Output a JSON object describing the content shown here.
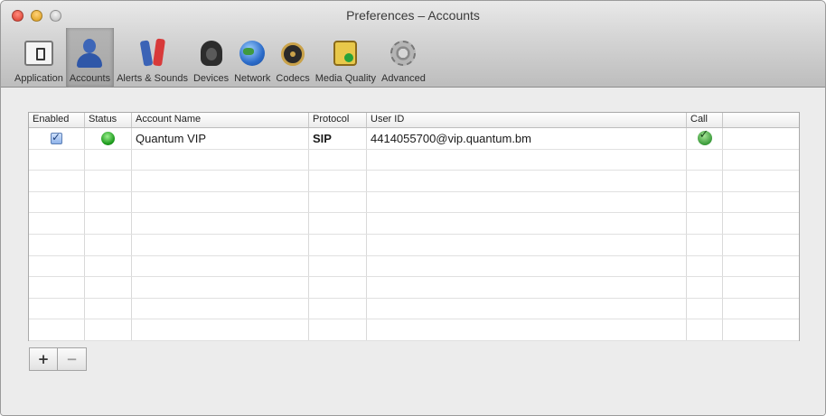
{
  "window": {
    "title": "Preferences – Accounts"
  },
  "toolbar": {
    "items": [
      {
        "label": "Application",
        "icon": "application-icon",
        "selected": false
      },
      {
        "label": "Accounts",
        "icon": "accounts-icon",
        "selected": true
      },
      {
        "label": "Alerts & Sounds",
        "icon": "alerts-sounds-icon",
        "selected": false
      },
      {
        "label": "Devices",
        "icon": "devices-icon",
        "selected": false
      },
      {
        "label": "Network",
        "icon": "network-icon",
        "selected": false
      },
      {
        "label": "Codecs",
        "icon": "codecs-icon",
        "selected": false
      },
      {
        "label": "Media Quality",
        "icon": "media-quality-icon",
        "selected": false
      },
      {
        "label": "Advanced",
        "icon": "advanced-icon",
        "selected": false
      }
    ]
  },
  "accounts_table": {
    "columns": [
      "Enabled",
      "Status",
      "Account Name",
      "Protocol",
      "User ID",
      "Call",
      ""
    ],
    "rows": [
      {
        "enabled": true,
        "status": "online",
        "account_name": "Quantum VIP",
        "protocol": "SIP",
        "user_id": "4414055700@vip.quantum.bm",
        "call": true
      }
    ],
    "empty_rows": 9
  },
  "buttons": {
    "add": "+",
    "remove": "−"
  },
  "colors": {
    "status_online": "#1c9a1c",
    "selected_tab": "#a9a9a9"
  }
}
